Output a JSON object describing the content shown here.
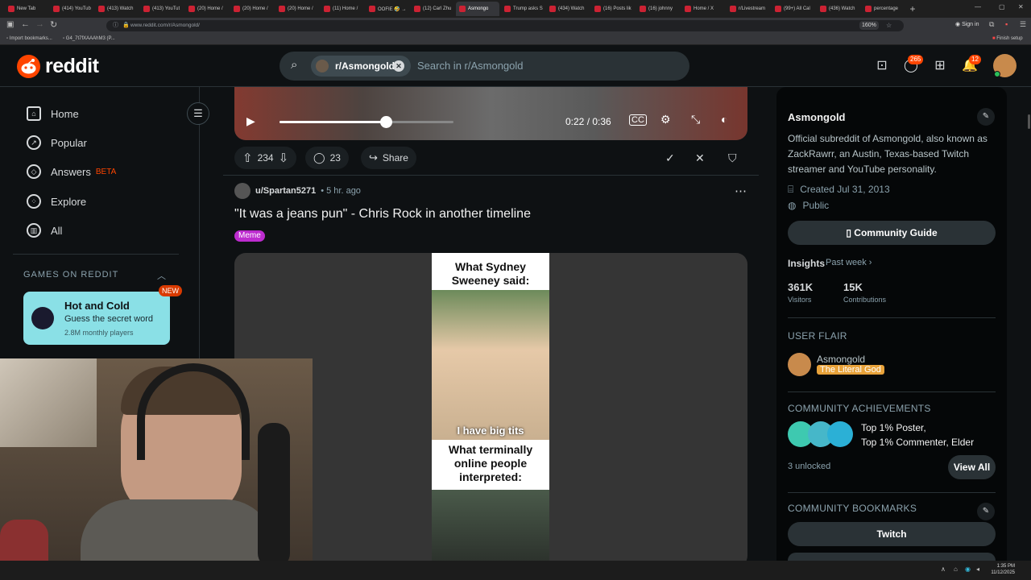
{
  "browser": {
    "tabs": [
      "New Tab",
      "(414) YouTub",
      "(413) Watch",
      "(413) YouTut",
      "(20) Home /",
      "(20) Home /",
      "(20) Home /",
      "(11) Home /",
      "OOFIE 🤣 →",
      "(12) Carl Zhu",
      "Asmongo",
      "Trump asks S",
      "(434) Watch",
      "(16) Posts lik",
      "(16) johnny",
      "Home / X",
      "r/Livestream",
      "(99+) All Cal",
      "(436) Watch",
      "percentage"
    ],
    "active_tab_index": 10,
    "url": "www.reddit.com/r/Asmongold/",
    "zoom": "160%",
    "sign_in": "Sign in",
    "bookmarks": [
      "Import bookmarks...",
      "G4_7t7fXAAAhM3 (P..."
    ],
    "finish_setup": "Finish setup"
  },
  "header": {
    "logo_text": "reddit",
    "search_chip": "r/Asmongold",
    "search_placeholder": "Search in r/Asmongold",
    "chat_badge": "265",
    "notif_badge": "12"
  },
  "sidebar": {
    "items": [
      {
        "label": "Home",
        "icon": "home-icon"
      },
      {
        "label": "Popular",
        "icon": "popular-icon"
      },
      {
        "label": "Answers",
        "icon": "answers-icon",
        "badge": "BETA"
      },
      {
        "label": "Explore",
        "icon": "explore-icon"
      },
      {
        "label": "All",
        "icon": "all-icon"
      }
    ],
    "games_heading": "GAMES ON REDDIT",
    "game": {
      "title": "Hot and Cold",
      "subtitle": "Guess the secret word",
      "players": "2.8M monthly players",
      "badge": "NEW"
    }
  },
  "video": {
    "time": "0:22 / 0:36",
    "progress": 0.61
  },
  "actions": {
    "votes": "234",
    "comments": "23",
    "share": "Share"
  },
  "post": {
    "author": "u/Spartan5271",
    "age": "• 5 hr. ago",
    "title": "\"It was a jeans pun\" - Chris Rock in another timeline",
    "flair": "Meme",
    "meme_cap_top": "What Sydney Sweeney said:",
    "meme_cap_mid": "I have big tits",
    "meme_cap_bottom": "What terminally online people interpreted:"
  },
  "community": {
    "name": "Asmongold",
    "description": "Official subreddit of Asmongold, also known as ZackRawrr, an Austin, Texas-based Twitch streamer and YouTube personality.",
    "created": "Created Jul 31, 2013",
    "visibility": "Public",
    "guide_button": "Community Guide",
    "insights_label": "Insights",
    "insights_period": "Past week",
    "visitors_value": "361K",
    "visitors_label": "Visitors",
    "contrib_value": "15K",
    "contrib_label": "Contributions",
    "flair_heading": "USER FLAIR",
    "flair_user": "Asmongold",
    "flair_text": "The Literal God",
    "achievements_heading": "COMMUNITY ACHIEVEMENTS",
    "achievements_line1": "Top 1% Poster,",
    "achievements_line2": "Top 1% Commenter, Elder",
    "unlocked": "3 unlocked",
    "view_all": "View All",
    "bookmarks_heading": "COMMUNITY BOOKMARKS",
    "bookmark_1": "Twitch"
  },
  "taskbar": {
    "time": "1:35 PM",
    "date": "11/12/2025"
  }
}
